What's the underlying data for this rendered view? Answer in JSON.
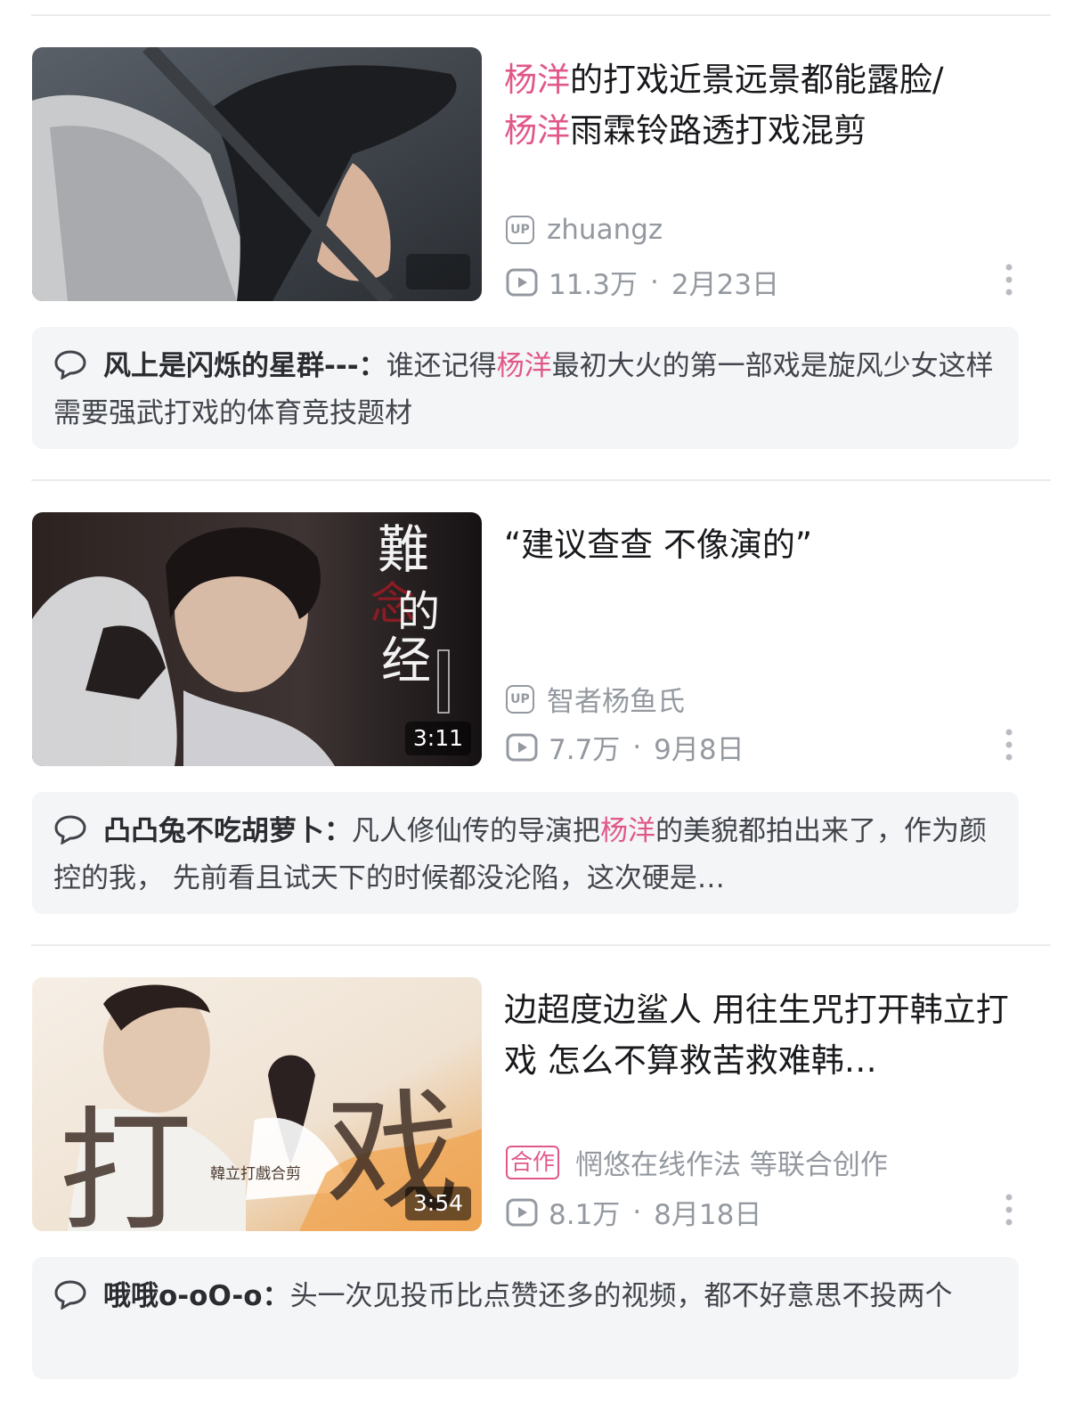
{
  "colors": {
    "highlight": "#e0588a",
    "meta": "#9499a0",
    "comment_bg": "#f4f5f7"
  },
  "cards": [
    {
      "title_parts": [
        {
          "text": "杨洋",
          "hl": true
        },
        {
          "text": "的打戏近景远景都能露脸/",
          "hl": false
        },
        {
          "text": "杨洋",
          "hl": true
        },
        {
          "text": "雨霖铃路透打戏混剪",
          "hl": false
        }
      ],
      "duration": "",
      "author_badge": "UP",
      "author": "zhuangz",
      "views": "11.3万",
      "separator": "·",
      "date": "2月23日",
      "comment": {
        "user": "风上是闪烁的星群---：",
        "parts": [
          {
            "text": "谁还记得",
            "hl": false
          },
          {
            "text": "杨洋",
            "hl": true
          },
          {
            "text": "最初大火的第一部戏是旋风少女这样需要强武打戏的体育竞技题材",
            "hl": false
          }
        ]
      }
    },
    {
      "title_parts": [
        {
          "text": "“建议查查 不像演的”",
          "hl": false
        }
      ],
      "duration": "3:11",
      "thumb_text": [
        "難",
        "的",
        "经",
        "念"
      ],
      "author_badge": "UP",
      "author": "智者杨鱼氏",
      "views": "7.7万",
      "separator": "·",
      "date": "9月8日",
      "comment": {
        "user": "凸凸兔不吃胡萝卜：",
        "parts": [
          {
            "text": "凡人修仙传的导演把",
            "hl": false
          },
          {
            "text": "杨洋",
            "hl": true
          },
          {
            "text": "的美貌都拍出来了，作为颜控的我， 先前看且试天下的时候都没沦陷，这次硬是…",
            "hl": false
          }
        ]
      }
    },
    {
      "title_parts": [
        {
          "text": "边超度边鲨人 用往生咒打开韩立打戏 怎么不算救苦救难韩…",
          "hl": false
        }
      ],
      "duration": "3:54",
      "thumb_text": [
        "打",
        "戏",
        "韓立打戲合剪"
      ],
      "author_badge": "合作",
      "author": "惘悠在线作法 等联合创作",
      "views": "8.1万",
      "separator": "·",
      "date": "8月18日",
      "comment": {
        "user": "哦哦o-oO-o：",
        "parts": [
          {
            "text": "头一次见投币比点赞还多的视频，都不好意思不投两个",
            "hl": false
          }
        ]
      }
    }
  ]
}
